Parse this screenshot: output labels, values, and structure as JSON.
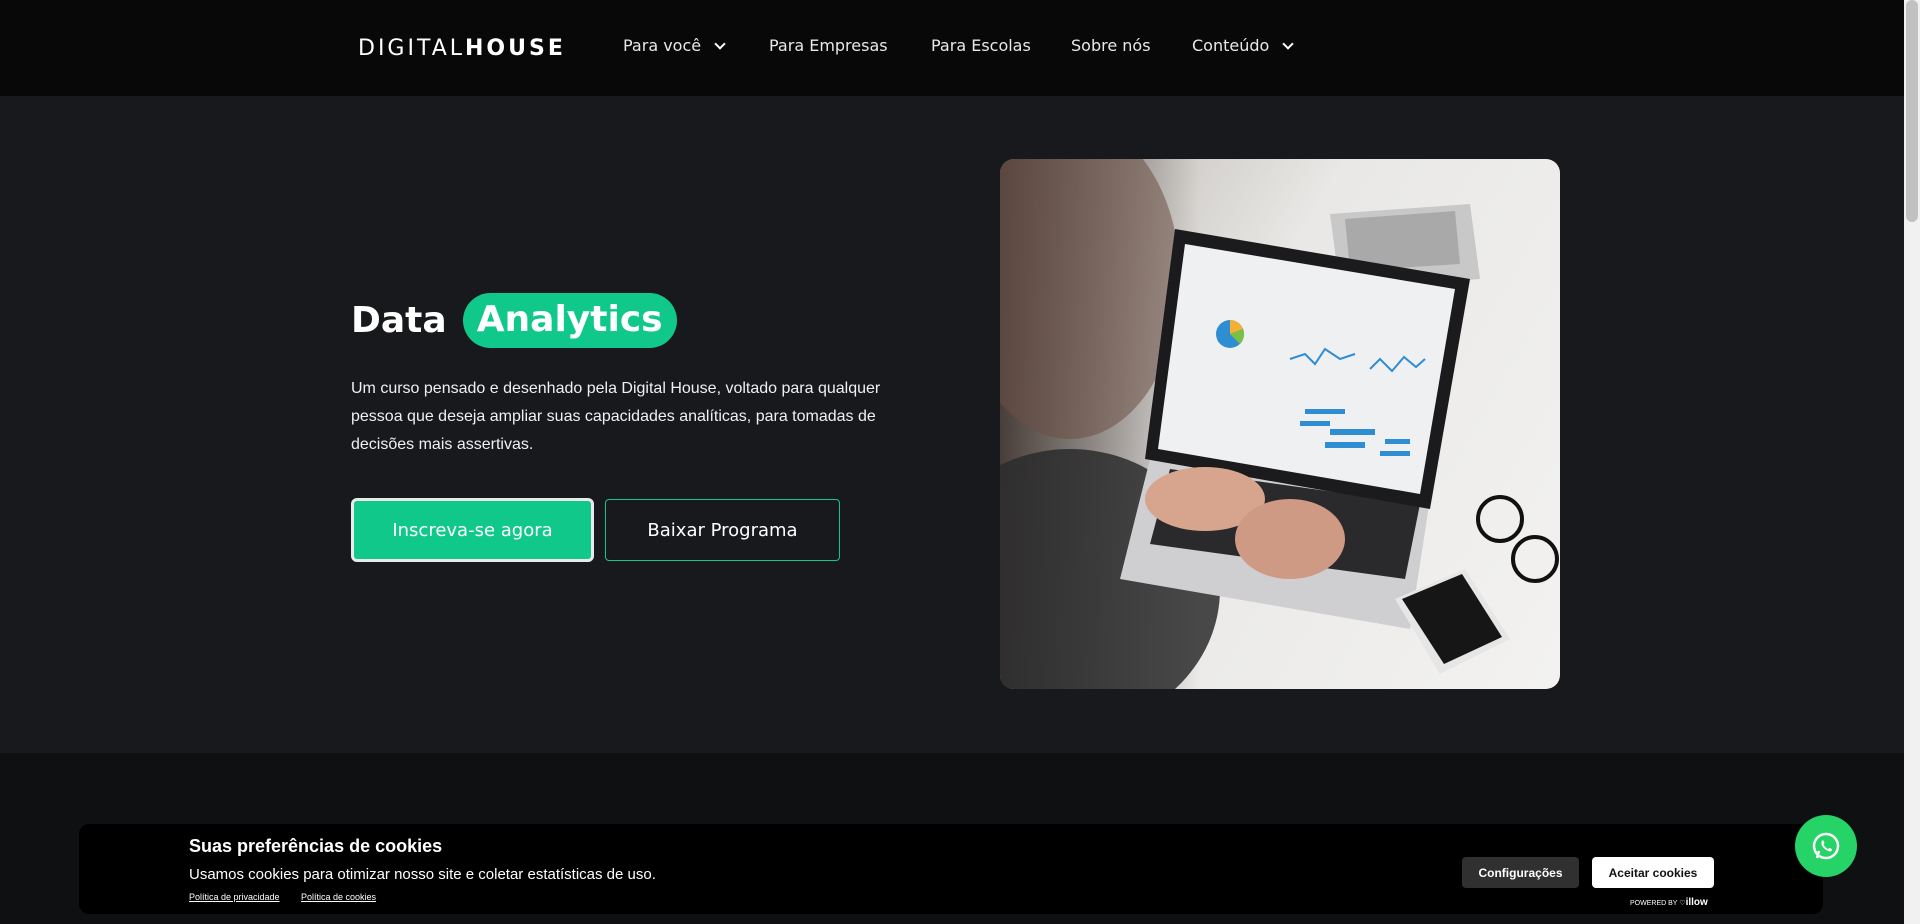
{
  "header": {
    "logo_part1": "DIGITAL",
    "logo_part2": "HOUSE",
    "nav": [
      {
        "label": "Para você",
        "has_dropdown": true
      },
      {
        "label": "Para Empresas",
        "has_dropdown": false
      },
      {
        "label": "Para Escolas",
        "has_dropdown": false
      },
      {
        "label": "Sobre nós",
        "has_dropdown": false
      },
      {
        "label": "Conteúdo",
        "has_dropdown": true
      }
    ]
  },
  "hero": {
    "title_word1": "Data",
    "title_word2": "Analytics",
    "description": "Um curso pensado e desenhado pela Digital House, voltado para qualquer pessoa que deseja ampliar suas capacidades analíticas, para tomadas de decisões mais assertivas.",
    "primary_button": "Inscreva-se agora",
    "secondary_button": "Baixar Programa"
  },
  "cookie_banner": {
    "title": "Suas preferências de cookies",
    "text": "Usamos cookies para otimizar nosso site e coletar estatísticas de uso.",
    "link_privacy": "Política de privacidade",
    "link_cookies": "Política de cookies",
    "config_button": "Configurações",
    "accept_button": "Aceitar cookies",
    "powered_by": "POWERED BY",
    "powered_brand": "illow"
  },
  "colors": {
    "accent": "#10c88a",
    "header_bg": "#080808",
    "hero_bg": "#18191c"
  }
}
